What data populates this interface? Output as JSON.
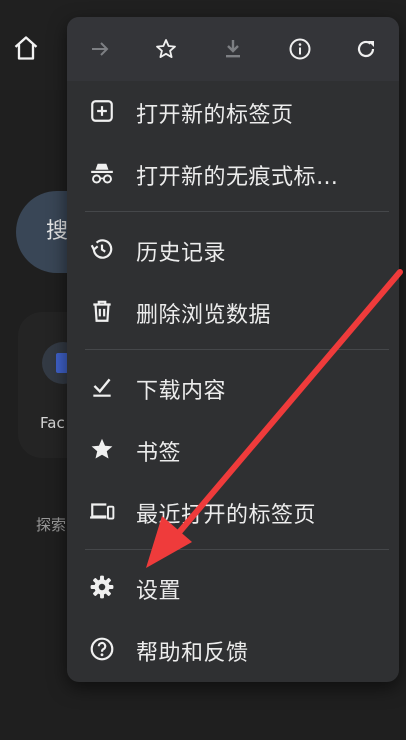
{
  "background": {
    "search_text": "搜",
    "shortcut_label": "Fac",
    "explore_text": "探索"
  },
  "toolbar": {
    "icons": [
      "forward-icon",
      "star-outline-icon",
      "download-icon",
      "info-icon",
      "refresh-icon"
    ]
  },
  "menu": {
    "items": [
      {
        "label": "打开新的标签页",
        "icon": "new-tab-icon"
      },
      {
        "label": "打开新的无痕式标…",
        "icon": "incognito-icon"
      },
      {
        "label": "历史记录",
        "icon": "history-icon"
      },
      {
        "label": "删除浏览数据",
        "icon": "trash-icon"
      },
      {
        "label": "下载内容",
        "icon": "downloads-icon"
      },
      {
        "label": "书签",
        "icon": "star-filled-icon"
      },
      {
        "label": "最近打开的标签页",
        "icon": "recent-tabs-icon"
      },
      {
        "label": "设置",
        "icon": "gear-icon"
      },
      {
        "label": "帮助和反馈",
        "icon": "help-icon"
      }
    ]
  },
  "colors": {
    "annotation_arrow": "#ef3b3b",
    "menu_background": "#2f3032"
  }
}
